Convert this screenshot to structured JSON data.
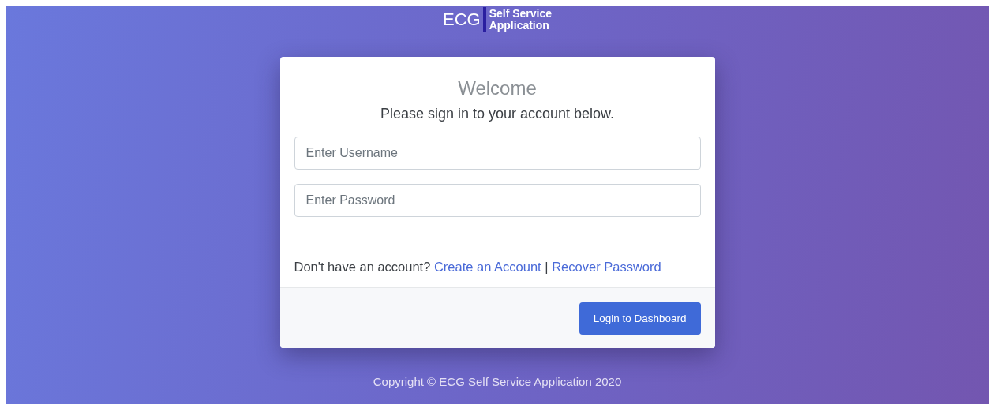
{
  "logo": {
    "mark": "ECG",
    "line_1": "Self Service",
    "line_2": "Application"
  },
  "card": {
    "title": "Welcome",
    "subtitle": "Please sign in to your account below.",
    "fields": [
      {
        "placeholder": "Enter Username"
      },
      {
        "placeholder": "Enter Password"
      }
    ],
    "prompt": "Don't have an account?",
    "links": [
      "Create an Account",
      "Recover Password"
    ],
    "separator": "|",
    "button": "Login to Dashboard"
  },
  "footer": "Copyright © ECG Self Service Application 2020"
}
